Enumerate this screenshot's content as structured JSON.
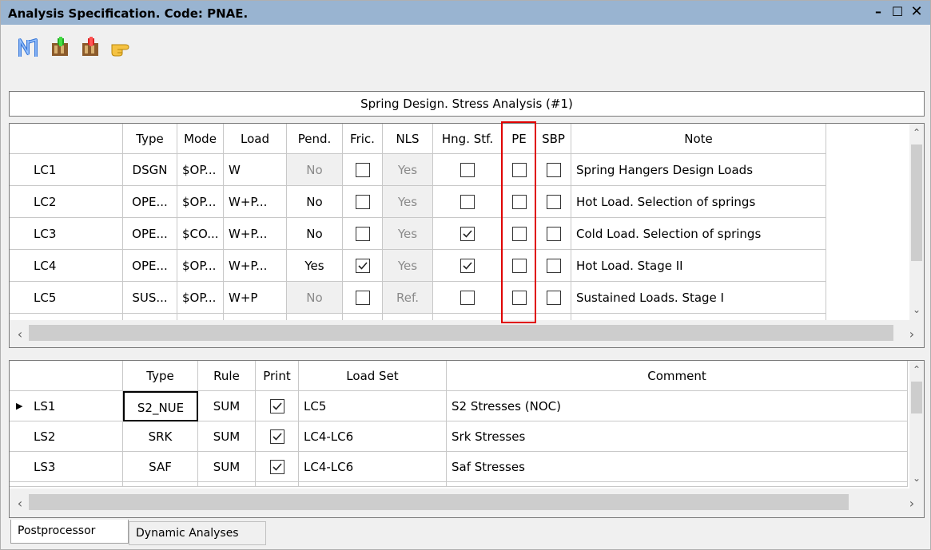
{
  "window": {
    "title": "Analysis Specification. Code: PNAE.",
    "min_glyph": "–",
    "max_glyph": "☐",
    "close_glyph": "✕"
  },
  "toolbar": {
    "icons": [
      "network-icon",
      "add-load-case-icon",
      "delete-load-case-icon",
      "pointer-hand-icon"
    ]
  },
  "panel": {
    "caption": "Spring Design. Stress Analysis (#1)"
  },
  "load_cases": {
    "columns": [
      "Type",
      "Mode",
      "Load",
      "Pend.",
      "Fric.",
      "NLS",
      "Hng. Stf.",
      "PE",
      "SBP",
      "Note"
    ],
    "rows": [
      {
        "id": "LC1",
        "type": "DSGN",
        "mode": "$OP...",
        "load": "W",
        "pend": "No",
        "pend_disabled": true,
        "fric": false,
        "nls": "Yes",
        "nls_disabled": true,
        "hng": false,
        "pe": false,
        "sbp": false,
        "note": "Spring Hangers Design Loads"
      },
      {
        "id": "LC2",
        "type": "OPE...",
        "mode": "$OP...",
        "load": "W+P...",
        "pend": "No",
        "pend_disabled": false,
        "fric": false,
        "nls": "Yes",
        "nls_disabled": true,
        "hng": false,
        "pe": false,
        "sbp": false,
        "note": "Hot Load. Selection of springs"
      },
      {
        "id": "LC3",
        "type": "OPE...",
        "mode": "$CO...",
        "load": "W+P...",
        "pend": "No",
        "pend_disabled": false,
        "fric": false,
        "nls": "Yes",
        "nls_disabled": true,
        "hng": true,
        "pe": false,
        "sbp": false,
        "note": "Cold Load. Selection of springs"
      },
      {
        "id": "LC4",
        "type": "OPE...",
        "mode": "$OP...",
        "load": "W+P...",
        "pend": "Yes",
        "pend_disabled": false,
        "fric": true,
        "nls": "Yes",
        "nls_disabled": true,
        "hng": true,
        "pe": false,
        "sbp": false,
        "note": "Hot Load. Stage II"
      },
      {
        "id": "LC5",
        "type": "SUS...",
        "mode": "$OP...",
        "load": "W+P",
        "pend": "No",
        "pend_disabled": true,
        "fric": false,
        "nls": "Ref.",
        "nls_disabled": true,
        "hng": false,
        "pe": false,
        "sbp": false,
        "note": "Sustained Loads. Stage I"
      }
    ]
  },
  "load_sets": {
    "columns": [
      "Type",
      "Rule",
      "Print",
      "Load Set",
      "Comment"
    ],
    "rows": [
      {
        "id": "LS1",
        "current": true,
        "type": "S2_NUE",
        "rule": "SUM",
        "print": true,
        "load_set": "LC5",
        "comment": "S2 Stresses (NOC)"
      },
      {
        "id": "LS2",
        "current": false,
        "type": "SRK",
        "rule": "SUM",
        "print": true,
        "load_set": "LC4-LC6",
        "comment": "Srk Stresses"
      },
      {
        "id": "LS3",
        "current": false,
        "type": "SAF",
        "rule": "SUM",
        "print": true,
        "load_set": "LC4-LC6",
        "comment": "Saf Stresses"
      }
    ]
  },
  "tabs": [
    {
      "label": "Postprocessor",
      "active": true
    },
    {
      "label": "Dynamic Analyses",
      "active": false
    }
  ],
  "highlight": {
    "column": "PE",
    "color": "#e00000"
  }
}
